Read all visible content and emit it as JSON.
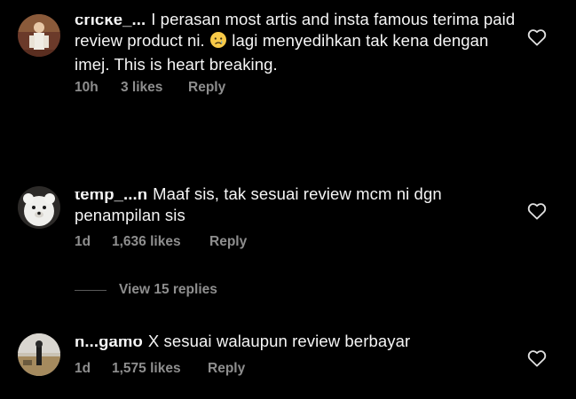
{
  "comments": [
    {
      "username": "cricke_...",
      "text_before_emoji": "I perasan most artis and insta famous terima paid review product ni.",
      "emoji": "crying-face",
      "text_after_emoji": "lagi menyedihkan tak kena dengan imej. This is heart breaking.",
      "time": "10h",
      "likes": "3 likes",
      "reply_label": "Reply"
    },
    {
      "username": "temp_...n",
      "text": "Maaf sis, tak sesuai review mcm ni dgn penampilan sis",
      "time": "1d",
      "likes": "1,636 likes",
      "reply_label": "Reply",
      "view_replies": "View 15 replies"
    },
    {
      "username": "n...gamo",
      "text": "X sesuai walaupun review berbayar",
      "time": "1d",
      "likes": "1,575 likes",
      "reply_label": "Reply"
    }
  ],
  "colors": {
    "background": "#000000",
    "text": "#f5f5f5",
    "secondary": "#8e8e8e"
  },
  "icons": {
    "like": "heart-outline-icon",
    "emoji": "crying-face-emoji"
  }
}
